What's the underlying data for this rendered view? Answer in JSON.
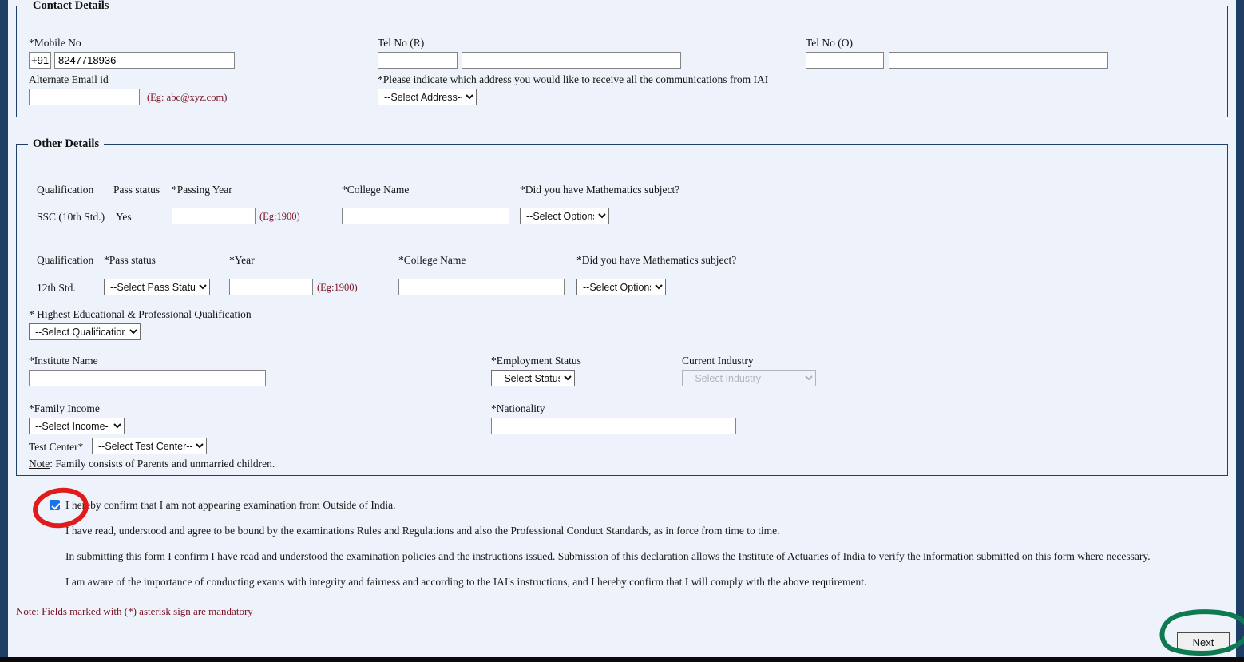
{
  "contact": {
    "legend": "Contact Details",
    "mobile_label": "*Mobile No",
    "mobile_code": "+91",
    "mobile_value": "8247718936",
    "alt_email_label": "Alternate Email id",
    "alt_email_value": "",
    "alt_email_hint": "(Eg: abc@xyz.com)",
    "tel_r_label": "Tel No (R)",
    "tel_r_code": "",
    "tel_r_value": "",
    "tel_o_label": "Tel No (O)",
    "tel_o_code": "",
    "tel_o_value": "",
    "address_pref_label": "*Please indicate which address you would like to receive all the communications from IAI",
    "address_select": "--Select Address--"
  },
  "other": {
    "legend": "Other Details",
    "ssc": {
      "qualification_header": "Qualification",
      "pass_status_header": "Pass status",
      "year_header": "*Passing Year",
      "college_header": "*College Name",
      "maths_header": "*Did you have Mathematics subject?",
      "qualification": "SSC (10th Std.)",
      "pass_status": "Yes",
      "year_value": "",
      "year_hint": "(Eg:1900)",
      "college_value": "",
      "maths_select": "--Select Options--"
    },
    "hsc": {
      "qualification_header": "Qualification",
      "pass_status_header": "*Pass status",
      "year_header": "*Year",
      "college_header": "*College Name",
      "maths_header": "*Did you have Mathematics subject?",
      "qualification": "12th Std.",
      "pass_status_select": "--Select Pass Status--",
      "year_value": "",
      "year_hint": "(Eg:1900)",
      "college_value": "",
      "maths_select": "--Select Options--"
    },
    "highest_qual_label": "* Highest Educational & Professional Qualification",
    "highest_qual_select": "--Select Qualification--",
    "institute_label": "*Institute Name",
    "institute_value": "",
    "employment_label": "*Employment Status",
    "employment_select": "--Select Status--",
    "industry_label": "Current Industry",
    "industry_select": "--Select Industry--",
    "family_income_label": "*Family Income",
    "family_income_select": "--Select Income--",
    "nationality_label": "*Nationality",
    "nationality_value": "",
    "test_center_label": "Test Center*",
    "test_center_select": "--Select Test Center--",
    "family_note_word": "Note",
    "family_note_rest": ": Family consists of Parents and unmarried children."
  },
  "declaration": {
    "checkbox_checked": true,
    "checkbox_text": "I hereby confirm that I am not appearing examination from Outside of India.",
    "para1": "I have read, understood and agree to be bound by the examinations Rules and Regulations and also the Professional Conduct Standards, as in force from time to time.",
    "para2": "In submitting this form I confirm I have read and understood the examination policies and the instructions issued. Submission of this declaration allows the Institute of Actuaries of India to verify the information submitted on this form where necessary.",
    "para3": "I am aware of the importance of conducting exams with integrity and fairness and according to the IAI's instructions, and I hereby confirm that I will comply with the above requirement."
  },
  "footer": {
    "note_word": "Note",
    "note_rest": ": Fields marked with (*) asterisk sign are mandatory",
    "next_label": "Next"
  },
  "annotations": {
    "red_ellipse_color": "#e01b1b",
    "green_ellipse_color": "#0d7a52"
  },
  "colors": {
    "page_bg": "#eef2fa",
    "rail": "#1d3f66",
    "fieldset_border": "#1f3f68",
    "hint_text": "#7a1020",
    "checkbox_blue": "#1a73e8"
  }
}
